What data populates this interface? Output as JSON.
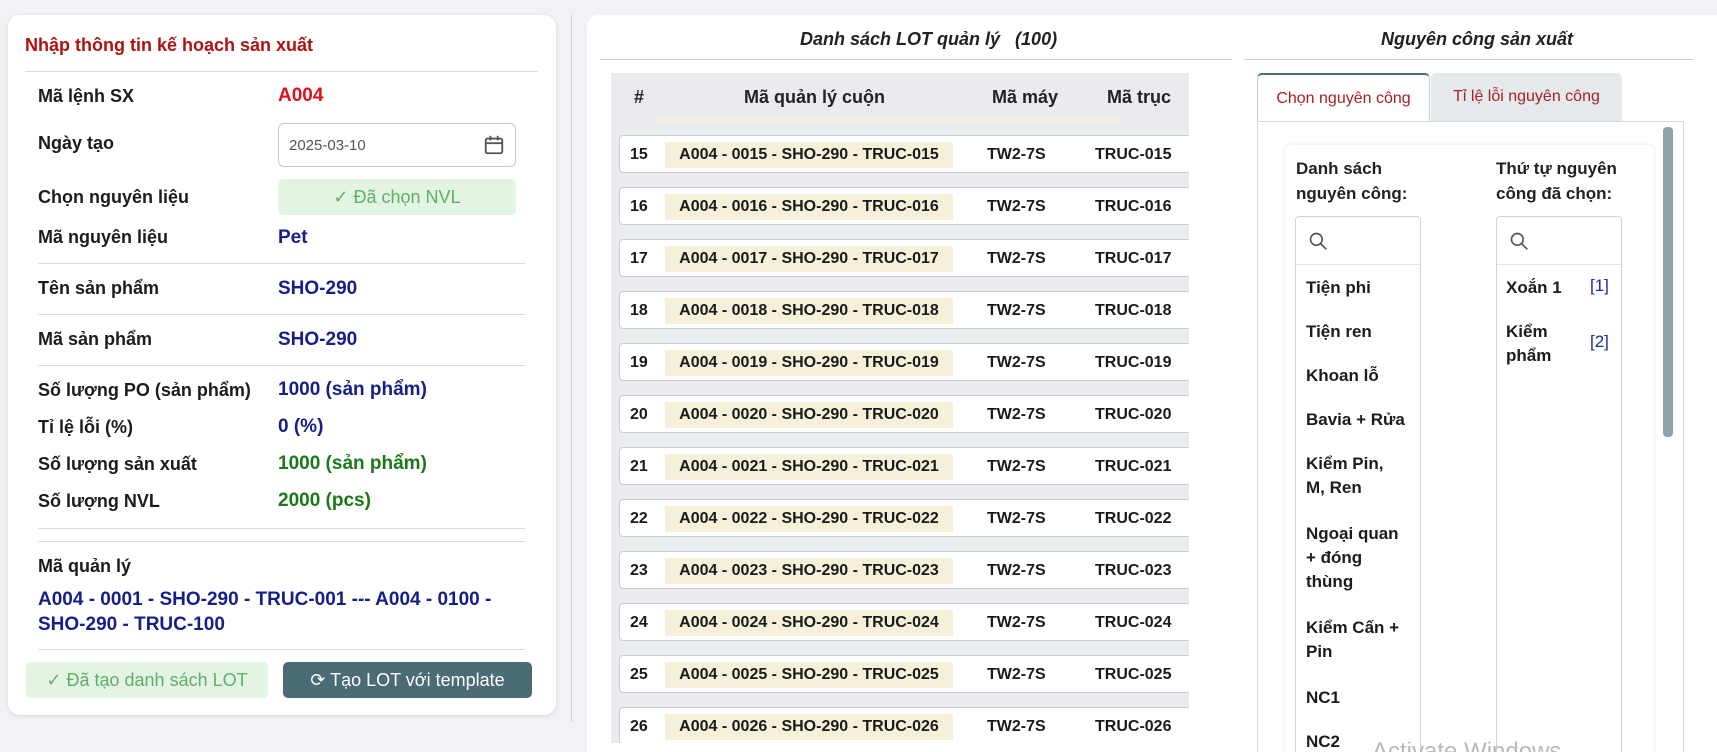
{
  "form": {
    "title": "Nhập thông tin kế hoạch sản xuất",
    "fields": {
      "ma_lenh_label": "Mã lệnh SX",
      "ma_lenh_value": "A004",
      "ngay_tao_label": "Ngày tạo",
      "ngay_tao_value": "2025-03-10",
      "chon_nl_label": "Chọn nguyên liệu",
      "chon_nl_button": "Đã chọn NVL",
      "ma_nl_label": "Mã nguyên liệu",
      "ma_nl_value": "Pet",
      "ten_sp_label": "Tên sản phẩm",
      "ten_sp_value": "SHO-290",
      "ma_sp_label": "Mã sản phẩm",
      "ma_sp_value": "SHO-290",
      "sl_po_label": "Số lượng PO (sản phẩm)",
      "sl_po_value": "1000 (sản phẩm)",
      "tile_loi_label": "Tỉ lệ lỗi (%)",
      "tile_loi_value": "0 (%)",
      "sl_sx_label": "Số lượng sản xuất",
      "sl_sx_value": "1000 (sản phẩm)",
      "sl_nvl_label": "Số lượng NVL",
      "sl_nvl_value": "2000 (pcs)",
      "ma_ql_label": "Mã quản lý",
      "ma_ql_value": "A004 - 0001 - SHO-290 - TRUC-001 --- A004 - 0100 - SHO-290 - TRUC-100"
    },
    "btn_done": "Đã tạo danh sách LOT",
    "btn_template": "Tạo LOT với template"
  },
  "lot": {
    "title": "Danh sách LOT quản lý",
    "count": "(100)",
    "headers": [
      "#",
      "Mã quản lý cuộn",
      "Mã máy",
      "Mã trục"
    ],
    "rows": [
      {
        "n": "15",
        "code": "A004 - 0015 - SHO-290 - TRUC-015",
        "may": "TW2-7S",
        "truc": "TRUC-015"
      },
      {
        "n": "16",
        "code": "A004 - 0016 - SHO-290 - TRUC-016",
        "may": "TW2-7S",
        "truc": "TRUC-016"
      },
      {
        "n": "17",
        "code": "A004 - 0017 - SHO-290 - TRUC-017",
        "may": "TW2-7S",
        "truc": "TRUC-017"
      },
      {
        "n": "18",
        "code": "A004 - 0018 - SHO-290 - TRUC-018",
        "may": "TW2-7S",
        "truc": "TRUC-018"
      },
      {
        "n": "19",
        "code": "A004 - 0019 - SHO-290 - TRUC-019",
        "may": "TW2-7S",
        "truc": "TRUC-019"
      },
      {
        "n": "20",
        "code": "A004 - 0020 - SHO-290 - TRUC-020",
        "may": "TW2-7S",
        "truc": "TRUC-020"
      },
      {
        "n": "21",
        "code": "A004 - 0021 - SHO-290 - TRUC-021",
        "may": "TW2-7S",
        "truc": "TRUC-021"
      },
      {
        "n": "22",
        "code": "A004 - 0022 - SHO-290 - TRUC-022",
        "may": "TW2-7S",
        "truc": "TRUC-022"
      },
      {
        "n": "23",
        "code": "A004 - 0023 - SHO-290 - TRUC-023",
        "may": "TW2-7S",
        "truc": "TRUC-023"
      },
      {
        "n": "24",
        "code": "A004 - 0024 - SHO-290 - TRUC-024",
        "may": "TW2-7S",
        "truc": "TRUC-024"
      },
      {
        "n": "25",
        "code": "A004 - 0025 - SHO-290 - TRUC-025",
        "may": "TW2-7S",
        "truc": "TRUC-025"
      },
      {
        "n": "26",
        "code": "A004 - 0026 - SHO-290 - TRUC-026",
        "may": "TW2-7S",
        "truc": "TRUC-026"
      }
    ]
  },
  "process": {
    "title": "Nguyên công sản xuất",
    "tabs": [
      "Chọn nguyên công",
      "Tỉ lệ lỗi nguyên công"
    ],
    "list_title_1": "Danh sách",
    "list_title_2": "nguyên công:",
    "selected_title_1": "Thứ tự nguyên",
    "selected_title_2": "công đã chọn:",
    "items": [
      [
        "Tiện phi"
      ],
      [
        "Tiện ren"
      ],
      [
        "Khoan lỗ"
      ],
      [
        "Bavia + Rửa"
      ],
      [
        "Kiểm Pin,",
        "M, Ren"
      ],
      [
        "Ngoại quan",
        "+ đóng",
        "thùng"
      ],
      [
        "Kiểm Cấn +",
        "Pin"
      ],
      [
        "NC1"
      ],
      [
        "NC2"
      ]
    ],
    "selected": [
      {
        "l1": "Xoắn 1",
        "l2": "",
        "idx": "[1]"
      },
      {
        "l1": "Kiểm",
        "l2": "phẩm",
        "idx": "[2]"
      }
    ]
  },
  "watermark": "Activate Windows",
  "icons": {
    "calendar": "calendar-icon",
    "check": "check-icon",
    "refresh": "refresh-icon",
    "search": "search-icon"
  },
  "colors": {
    "title_red": "#b01212",
    "value_red": "#e0101a",
    "navy": "#141f8a",
    "green": "#1a7a1a",
    "button_dark": "#4b6b75",
    "success_bg": "#e3f4e3"
  }
}
